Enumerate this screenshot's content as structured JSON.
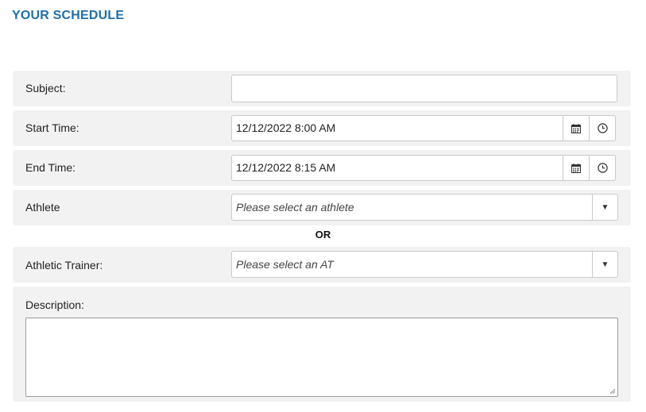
{
  "page": {
    "title": "YOUR SCHEDULE"
  },
  "form": {
    "subject": {
      "label": "Subject:",
      "value": ""
    },
    "start_time": {
      "label": "Start Time:",
      "value": "12/12/2022 8:00 AM"
    },
    "end_time": {
      "label": "End Time:",
      "value": "12/12/2022 8:15 AM"
    },
    "athlete": {
      "label": "Athlete",
      "placeholder": "Please select an athlete"
    },
    "or_text": "OR",
    "athletic_trainer": {
      "label": "Athletic Trainer:",
      "placeholder": "Please select an AT"
    },
    "description": {
      "label": "Description:",
      "value": ""
    }
  },
  "icons": {
    "calendar": "calendar-icon",
    "clock": "clock-icon",
    "dropdown": "caret-down-icon"
  },
  "colors": {
    "title": "#1f6fa8",
    "row_background": "#f2f2f2"
  }
}
